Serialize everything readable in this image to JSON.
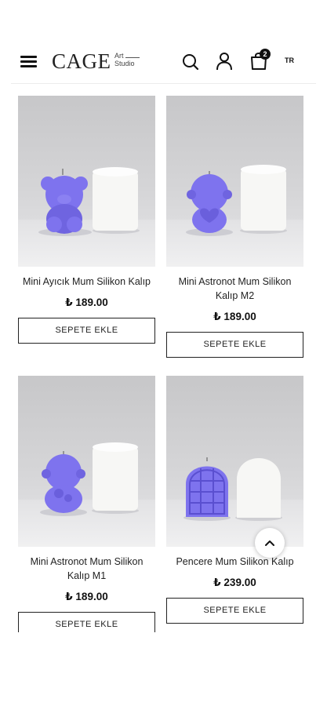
{
  "header": {
    "logo_main": "CAGE",
    "logo_sub_top": "Art",
    "logo_sub_bottom": "Studio",
    "cart_count": "2",
    "language": "TR"
  },
  "products": [
    {
      "title": "Mini Ayıcık Mum Silikon Kalıp",
      "price": "₺ 189.00",
      "button": "SEPETE EKLE"
    },
    {
      "title": "Mini Astronot Mum Silikon Kalıp M2",
      "price": "₺ 189.00",
      "button": "SEPETE EKLE"
    },
    {
      "title": "Mini Astronot Mum Silikon Kalıp M1",
      "price": "₺ 189.00",
      "button": "SEPETE EKLE"
    },
    {
      "title": "Pencere Mum Silikon Kalıp",
      "price": "₺ 239.00",
      "button": "SEPETE EKLE"
    }
  ],
  "colors": {
    "product_purple": "#7e73ee",
    "candle_white": "#f7f7f5"
  },
  "icons": [
    "menu-icon",
    "search-icon",
    "user-icon",
    "cart-icon",
    "chevron-up-icon"
  ]
}
